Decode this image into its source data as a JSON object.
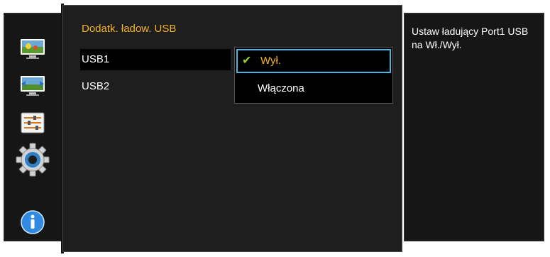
{
  "panel": {
    "title": "Dodatk. ładow. USB"
  },
  "menu": {
    "items": [
      {
        "label": "USB1"
      },
      {
        "label": "USB2"
      }
    ]
  },
  "dropdown": {
    "options": [
      {
        "label": "Wył.",
        "selected": true
      },
      {
        "label": "Włączona",
        "selected": false
      }
    ],
    "check_glyph": "✔"
  },
  "help": {
    "text": "Ustaw ładujący Port1 USB na Wł./Wył."
  },
  "rail": {
    "icons": [
      "picture-icon",
      "position-icon",
      "settings-sliders-icon",
      "system-gear-icon",
      "information-icon"
    ]
  },
  "colors": {
    "title_accent": "#f5b321",
    "focus_border": "#43b6e8",
    "check_color": "#8fd12a"
  }
}
